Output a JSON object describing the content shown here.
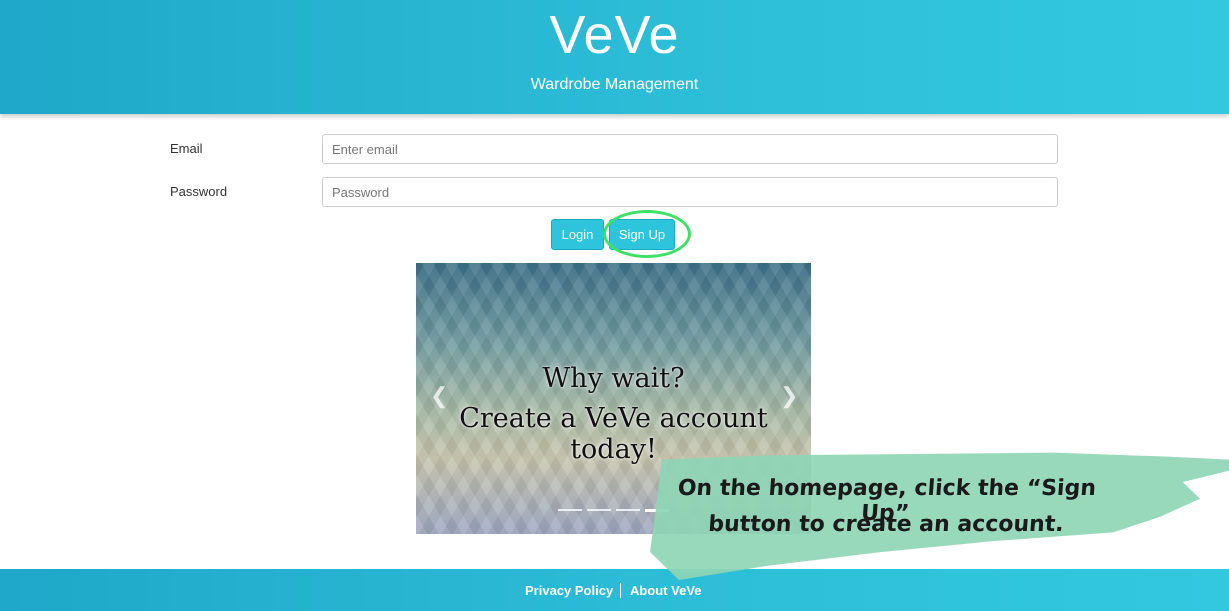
{
  "header": {
    "brand": "VeVe",
    "tagline": "Wardrobe Management"
  },
  "form": {
    "email_label": "Email",
    "email_placeholder": "Enter email",
    "password_label": "Password",
    "password_placeholder": "Password",
    "login_label": "Login",
    "signup_label": "Sign Up"
  },
  "carousel": {
    "line1": "Why wait?",
    "line2": "Create a VeVe account today!",
    "prev_icon": "chevron-left-icon",
    "next_icon": "chevron-right-icon",
    "indicator_count": 4,
    "active_indicator": 4
  },
  "callout": {
    "line1": "On the homepage, click the “Sign Up”",
    "line2": "button to create an account."
  },
  "footer": {
    "privacy": "Privacy Policy",
    "about": "About VeVe"
  },
  "colors": {
    "header": "#2ebfd8",
    "button": "#2ec4dc",
    "highlight": "#3ee068",
    "callout": "#8fd5b5"
  }
}
